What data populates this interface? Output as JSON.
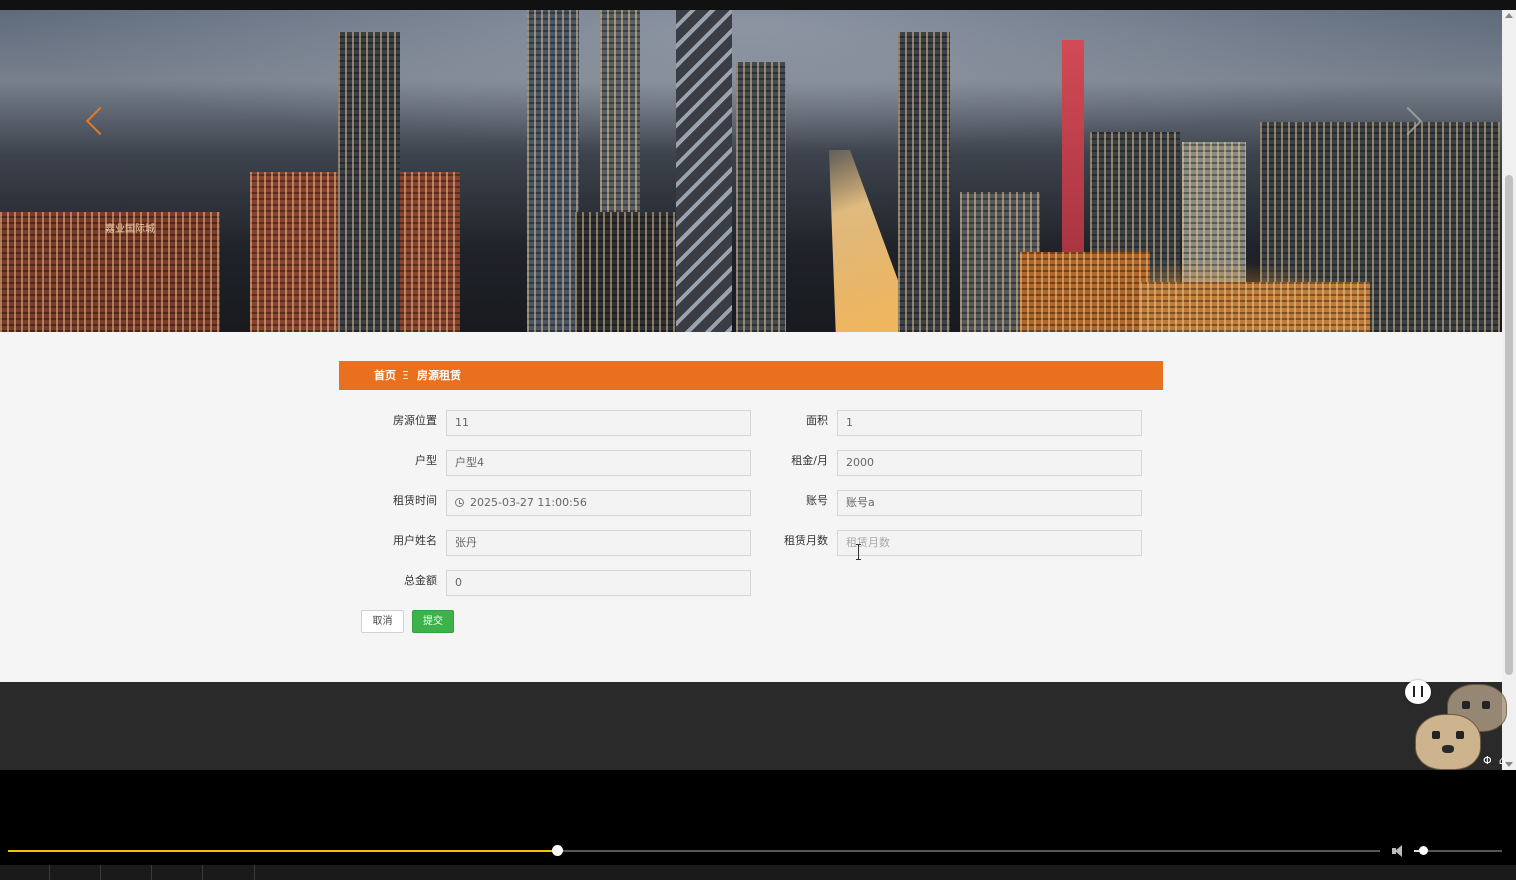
{
  "breadcrumb": {
    "home": "首页",
    "separator": "Ξ",
    "current": "房源租赁"
  },
  "form": {
    "fields": [
      {
        "key": "location",
        "label": "房源位置",
        "value": "11"
      },
      {
        "key": "area",
        "label": "面积",
        "value": "1"
      },
      {
        "key": "layout",
        "label": "户型",
        "value": "户型4"
      },
      {
        "key": "rent",
        "label": "租金/月",
        "value": "2000"
      },
      {
        "key": "rent_time",
        "label": "租赁时间",
        "value": "2025-03-27 11:00:56",
        "icon": "clock-icon"
      },
      {
        "key": "account",
        "label": "账号",
        "value": "账号a"
      },
      {
        "key": "user_name",
        "label": "用户姓名",
        "value": "张丹"
      },
      {
        "key": "months",
        "label": "租赁月数",
        "value": "",
        "placeholder": "租赁月数"
      },
      {
        "key": "total",
        "label": "总金额",
        "value": "0"
      }
    ],
    "cancel_label": "取消",
    "submit_label": "提交"
  },
  "banner": {
    "sign_text": "嘉业国际城"
  },
  "player": {
    "progress": 0.4,
    "volume": 0.1
  },
  "colors": {
    "accent": "#e8701e",
    "submit": "#3cb34a",
    "footer": "#2a2a2a",
    "seek": "#f2c200"
  }
}
